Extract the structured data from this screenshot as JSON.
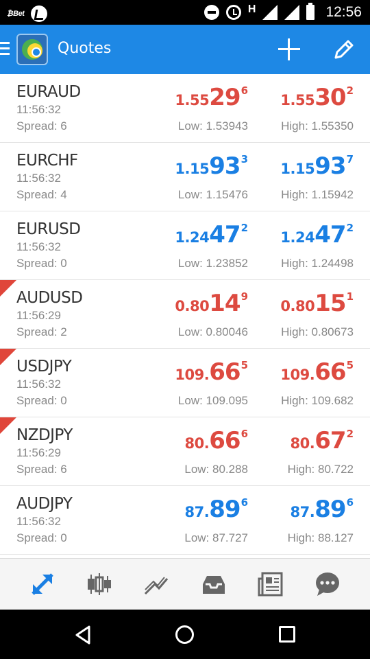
{
  "status_bar": {
    "app_label": "₿Bet",
    "network": "H",
    "time": "12:56"
  },
  "app_bar": {
    "title": "Quotes",
    "icons": [
      "menu-icon",
      "metatrader-logo",
      "add-icon",
      "edit-icon"
    ]
  },
  "colors": {
    "app_bar": "#1e88e5",
    "price_up": "#1a7fe3",
    "price_down": "#dd4a40",
    "down_flag": "#e0463a"
  },
  "quotes": [
    {
      "symbol": "EURAUD",
      "time": "11:56:32",
      "spread": "Spread: 6",
      "dir": "red",
      "flag": false,
      "bid": {
        "small": "1.55",
        "big": "29",
        "sup": "6"
      },
      "ask": {
        "small": "1.55",
        "big": "30",
        "sup": "2"
      },
      "low": "Low: 1.53943",
      "high": "High: 1.55350"
    },
    {
      "symbol": "EURCHF",
      "time": "11:56:32",
      "spread": "Spread: 4",
      "dir": "blue",
      "flag": false,
      "bid": {
        "small": "1.15",
        "big": "93",
        "sup": "3"
      },
      "ask": {
        "small": "1.15",
        "big": "93",
        "sup": "7"
      },
      "low": "Low: 1.15476",
      "high": "High: 1.15942"
    },
    {
      "symbol": "EURUSD",
      "time": "11:56:32",
      "spread": "Spread: 0",
      "dir": "blue",
      "flag": false,
      "bid": {
        "small": "1.24",
        "big": "47",
        "sup": "2"
      },
      "ask": {
        "small": "1.24",
        "big": "47",
        "sup": "2"
      },
      "low": "Low: 1.23852",
      "high": "High: 1.24498"
    },
    {
      "symbol": "AUDUSD",
      "time": "11:56:29",
      "spread": "Spread: 2",
      "dir": "red",
      "flag": true,
      "bid": {
        "small": "0.80",
        "big": "14",
        "sup": "9"
      },
      "ask": {
        "small": "0.80",
        "big": "15",
        "sup": "1"
      },
      "low": "Low: 0.80046",
      "high": "High: 0.80673"
    },
    {
      "symbol": "USDJPY",
      "time": "11:56:32",
      "spread": "Spread: 0",
      "dir": "red",
      "flag": true,
      "bid": {
        "small": "109.",
        "big": "66",
        "sup": "5"
      },
      "ask": {
        "small": "109.",
        "big": "66",
        "sup": "5"
      },
      "low": "Low: 109.095",
      "high": "High: 109.682"
    },
    {
      "symbol": "NZDJPY",
      "time": "11:56:29",
      "spread": "Spread: 6",
      "dir": "red",
      "flag": true,
      "bid": {
        "small": "80.",
        "big": "66",
        "sup": "6"
      },
      "ask": {
        "small": "80.",
        "big": "67",
        "sup": "2"
      },
      "low": "Low: 80.288",
      "high": "High: 80.722"
    },
    {
      "symbol": "AUDJPY",
      "time": "11:56:32",
      "spread": "Spread: 0",
      "dir": "blue",
      "flag": false,
      "bid": {
        "small": "87.",
        "big": "89",
        "sup": "6"
      },
      "ask": {
        "small": "87.",
        "big": "89",
        "sup": "6"
      },
      "low": "Low: 87.727",
      "high": "High: 88.127"
    }
  ],
  "bottom_tabs": [
    {
      "icon": "quotes-arrows-icon",
      "active": true
    },
    {
      "icon": "candlestick-chart-icon",
      "active": false
    },
    {
      "icon": "trade-icon",
      "active": false
    },
    {
      "icon": "history-inbox-icon",
      "active": false
    },
    {
      "icon": "news-icon",
      "active": false
    },
    {
      "icon": "chat-bubble-icon",
      "active": false
    }
  ],
  "nav_bar": {
    "icons": [
      "back-icon",
      "home-icon",
      "recent-apps-icon"
    ]
  }
}
